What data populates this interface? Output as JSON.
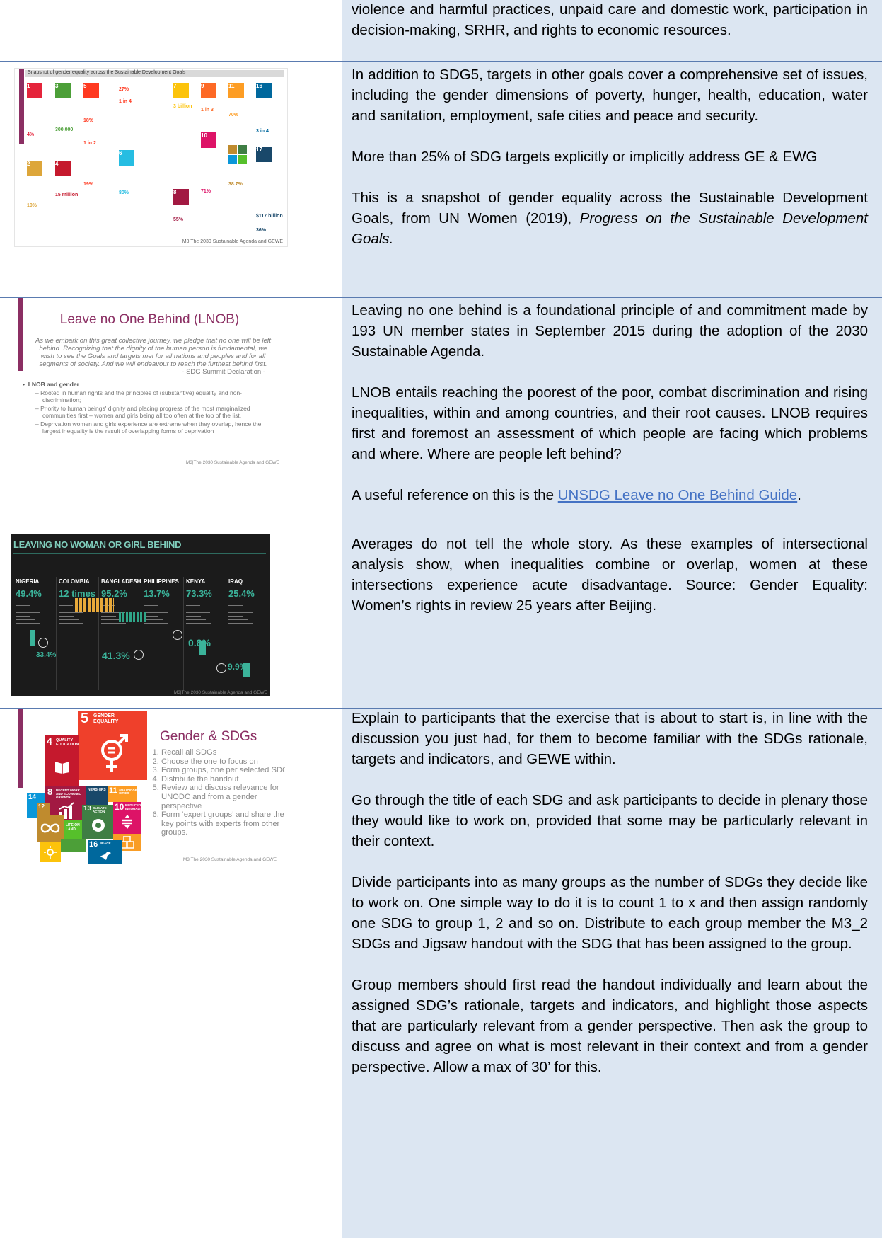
{
  "row1": {
    "text": "violence and harmful practices, unpaid care and domestic work, participation in decision-making, SRHR, and rights to economic resources."
  },
  "row2": {
    "slide": {
      "title": "Snapshot of gender equality across the Sustainable Development Goals",
      "footer": "M3|The 2030 Sustainable Agenda and GEWE",
      "stats": [
        "4%",
        "300,000",
        "18%",
        "1 in 2",
        "27%",
        "1 in 4",
        "3 billion",
        "1 in 3",
        "70%",
        "3 in 4",
        "10%",
        "15 million",
        "19%",
        "80%",
        "38.7%",
        "$117 billion",
        "71%",
        "55%",
        "36%"
      ]
    },
    "p1": "In addition to SDG5, targets in other goals cover a comprehensive set of issues, including the gender dimensions of poverty, hunger, health, education, water and sanitation, employment, safe cities and peace and security.",
    "p2": "More than 25% of SDG targets explicitly or implicitly address GE & EWG",
    "p3_pre": "This is a snapshot of gender equality across the Sustainable Development Goals, from UN Women (2019), ",
    "p3_italic": "Progress on the Sustainable Development Goals."
  },
  "row3": {
    "slide": {
      "title": "Leave no One Behind (LNOB)",
      "quote": "As we embark on this great collective journey, we pledge that no one will be left behind. Recognizing that the dignity of the human person is fundamental, we wish to see the Goals and targets met for all nations and peoples and for all segments of society. And we will endeavour to reach the furthest behind first.",
      "quote_source": "- SDG Summit Declaration -",
      "bullet_head": "LNOB and gender",
      "bullets": [
        "Rooted in human rights and the principles of (substantive) equality and non-discrimination;",
        "Priority to human beings' dignity and placing progress of the most marginalized communities first – women and girls being all too often at the top of the list.",
        "Deprivation women and girls experience are extreme when they overlap, hence the largest inequality is the result of overlapping forms of deprivation"
      ],
      "footer": "M3|The 2030 Sustainable Agenda and GEWE"
    },
    "p1": "Leaving no one behind is a foundational principle of and commitment made by 193 UN member states in September 2015 during the adoption of the 2030 Sustainable Agenda.",
    "p2": "LNOB entails reaching the poorest of the poor, combat discrimination and rising inequalities, within and among countries, and their root causes. LNOB requires first and foremost an assessment of which people are facing which problems and where. Where are people left behind?",
    "p3_pre": "A useful reference on this is the ",
    "p3_link": "UNSDG Leave no One Behind Guide",
    "p3_post": "."
  },
  "row4": {
    "slide": {
      "title": "LEAVING NO WOMAN OR GIRL BEHIND",
      "countries": [
        {
          "name": "NIGERIA",
          "stat": "49.4%"
        },
        {
          "name": "COLOMBIA",
          "stat": "12 times"
        },
        {
          "name": "BANGLADESH",
          "stat": "95.2%"
        },
        {
          "name": "PHILIPPINES",
          "stat": "13.7%"
        },
        {
          "name": "KENYA",
          "stat": "73.3%"
        },
        {
          "name": "IRAQ",
          "stat": "25.4%"
        }
      ],
      "second_stats": [
        "33.4%",
        "41.3%",
        "0.8%",
        "9.9%"
      ],
      "footer": "M3|The 2030 Sustainable Agenda and GEWE"
    },
    "p1": "Averages do not tell the whole story. As these examples of intersectional analysis show, when inequalities combine or overlap, women at these intersections experience acute disadvantage. Source: Gender Equality: Women’s rights in review 25 years after Beijing."
  },
  "row5": {
    "slide": {
      "title": "Gender & SDGs",
      "steps": [
        "Recall all SDGs",
        "Choose the one to focus on",
        "Form groups, one per selected SDG",
        "Distribute the handout",
        "Review and discuss relevance for UNODC and from a gender perspective",
        "Form ‘expert groups’ and share the key points with experts from other groups."
      ],
      "tiles": [
        {
          "num": "5",
          "label": "GENDER EQUALITY"
        },
        {
          "num": "4",
          "label": "QUALITY EDUCATION"
        },
        {
          "num": "8",
          "label": "DECENT WORK AND ECONOMIC GROWTH"
        },
        {
          "num": "10",
          "label": "REDUCED INEQUALITIES"
        },
        {
          "num": "11",
          "label": "SUSTAINABLE CITIES"
        },
        {
          "num": "13",
          "label": "CLIMATE ACTION"
        },
        {
          "num": "16",
          "label": "PEACE"
        },
        {
          "num": "14",
          "label": ""
        },
        {
          "num": "12",
          "label": ""
        }
      ],
      "footer": "M3|The 2030 Sustainable Agenda and GEWE"
    },
    "p1": "Explain to participants that the exercise that is about to start is, in line with the discussion you just had, for them to become familiar with the SDGs rationale, targets and indicators, and GEWE within.",
    "p2": "Go through the title of each SDG and ask participants to decide in plenary those they would like to work on, provided that some may be particularly relevant in their context.",
    "p3": "Divide participants into as many groups as the number of SDGs they decide like to work on. One simple way to do it is to count 1 to x and then assign randomly one SDG to group 1, 2 and so on. Distribute to each group member the M3_2 SDGs and Jigsaw handout with the SDG that has been assigned to the group.",
    "p4": "Group members should first read the handout individually and learn about the assigned SDG’s rationale, targets and indicators, and highlight those aspects that are particularly relevant from a gender perspective. Then ask the group to discuss and agree on what is most relevant in their context and from a gender perspective. Allow a max of 30’ for this."
  },
  "colors": {
    "cell_blue": "#dce6f2",
    "border": "#5a7bb0",
    "link": "#4472c4",
    "slide_accent": "#8b2f63"
  }
}
